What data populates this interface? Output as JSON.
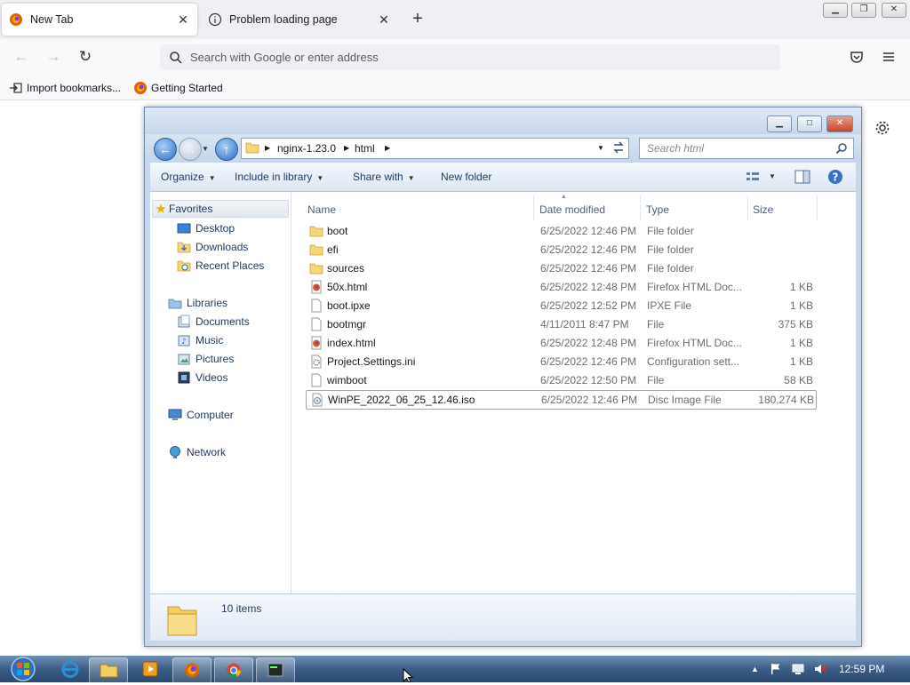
{
  "browser": {
    "tabs": [
      {
        "label": "New Tab",
        "active": true
      },
      {
        "label": "Problem loading page",
        "active": false
      }
    ],
    "url_placeholder": "Search with Google or enter address",
    "bookmarks": [
      {
        "label": "Import bookmarks..."
      },
      {
        "label": "Getting Started"
      }
    ]
  },
  "explorer": {
    "breadcrumb": [
      "nginx-1.23.0",
      "html"
    ],
    "search_placeholder": "Search html",
    "toolbar": {
      "organize": "Organize",
      "include": "Include in library",
      "share": "Share with",
      "new_folder": "New folder"
    },
    "nav": {
      "favorites": "Favorites",
      "desktop": "Desktop",
      "downloads": "Downloads",
      "recent": "Recent Places",
      "libraries": "Libraries",
      "documents": "Documents",
      "music": "Music",
      "pictures": "Pictures",
      "videos": "Videos",
      "computer": "Computer",
      "network": "Network"
    },
    "columns": {
      "name": "Name",
      "date": "Date modified",
      "type": "Type",
      "size": "Size"
    },
    "files": [
      {
        "name": "boot",
        "date": "6/25/2022 12:46 PM",
        "type": "File folder",
        "size": "",
        "icon": "folder-icon"
      },
      {
        "name": "efi",
        "date": "6/25/2022 12:46 PM",
        "type": "File folder",
        "size": "",
        "icon": "folder-icon"
      },
      {
        "name": "sources",
        "date": "6/25/2022 12:46 PM",
        "type": "File folder",
        "size": "",
        "icon": "folder-icon"
      },
      {
        "name": "50x.html",
        "date": "6/25/2022 12:48 PM",
        "type": "Firefox HTML Doc...",
        "size": "1 KB",
        "icon": "html-file-icon"
      },
      {
        "name": "boot.ipxe",
        "date": "6/25/2022 12:52 PM",
        "type": "IPXE File",
        "size": "1 KB",
        "icon": "file-icon"
      },
      {
        "name": "bootmgr",
        "date": "4/11/2011 8:47 PM",
        "type": "File",
        "size": "375 KB",
        "icon": "file-icon"
      },
      {
        "name": "index.html",
        "date": "6/25/2022 12:48 PM",
        "type": "Firefox HTML Doc...",
        "size": "1 KB",
        "icon": "html-file-icon"
      },
      {
        "name": "Project.Settings.ini",
        "date": "6/25/2022 12:46 PM",
        "type": "Configuration sett...",
        "size": "1 KB",
        "icon": "settings-file-icon"
      },
      {
        "name": "wimboot",
        "date": "6/25/2022 12:50 PM",
        "type": "File",
        "size": "58 KB",
        "icon": "file-icon"
      },
      {
        "name": "WinPE_2022_06_25_12.46.iso",
        "date": "6/25/2022 12:46 PM",
        "type": "Disc Image File",
        "size": "180,274 KB",
        "icon": "disc-image-icon"
      }
    ],
    "status": "10 items"
  },
  "taskbar": {
    "time": "12:59 PM"
  }
}
